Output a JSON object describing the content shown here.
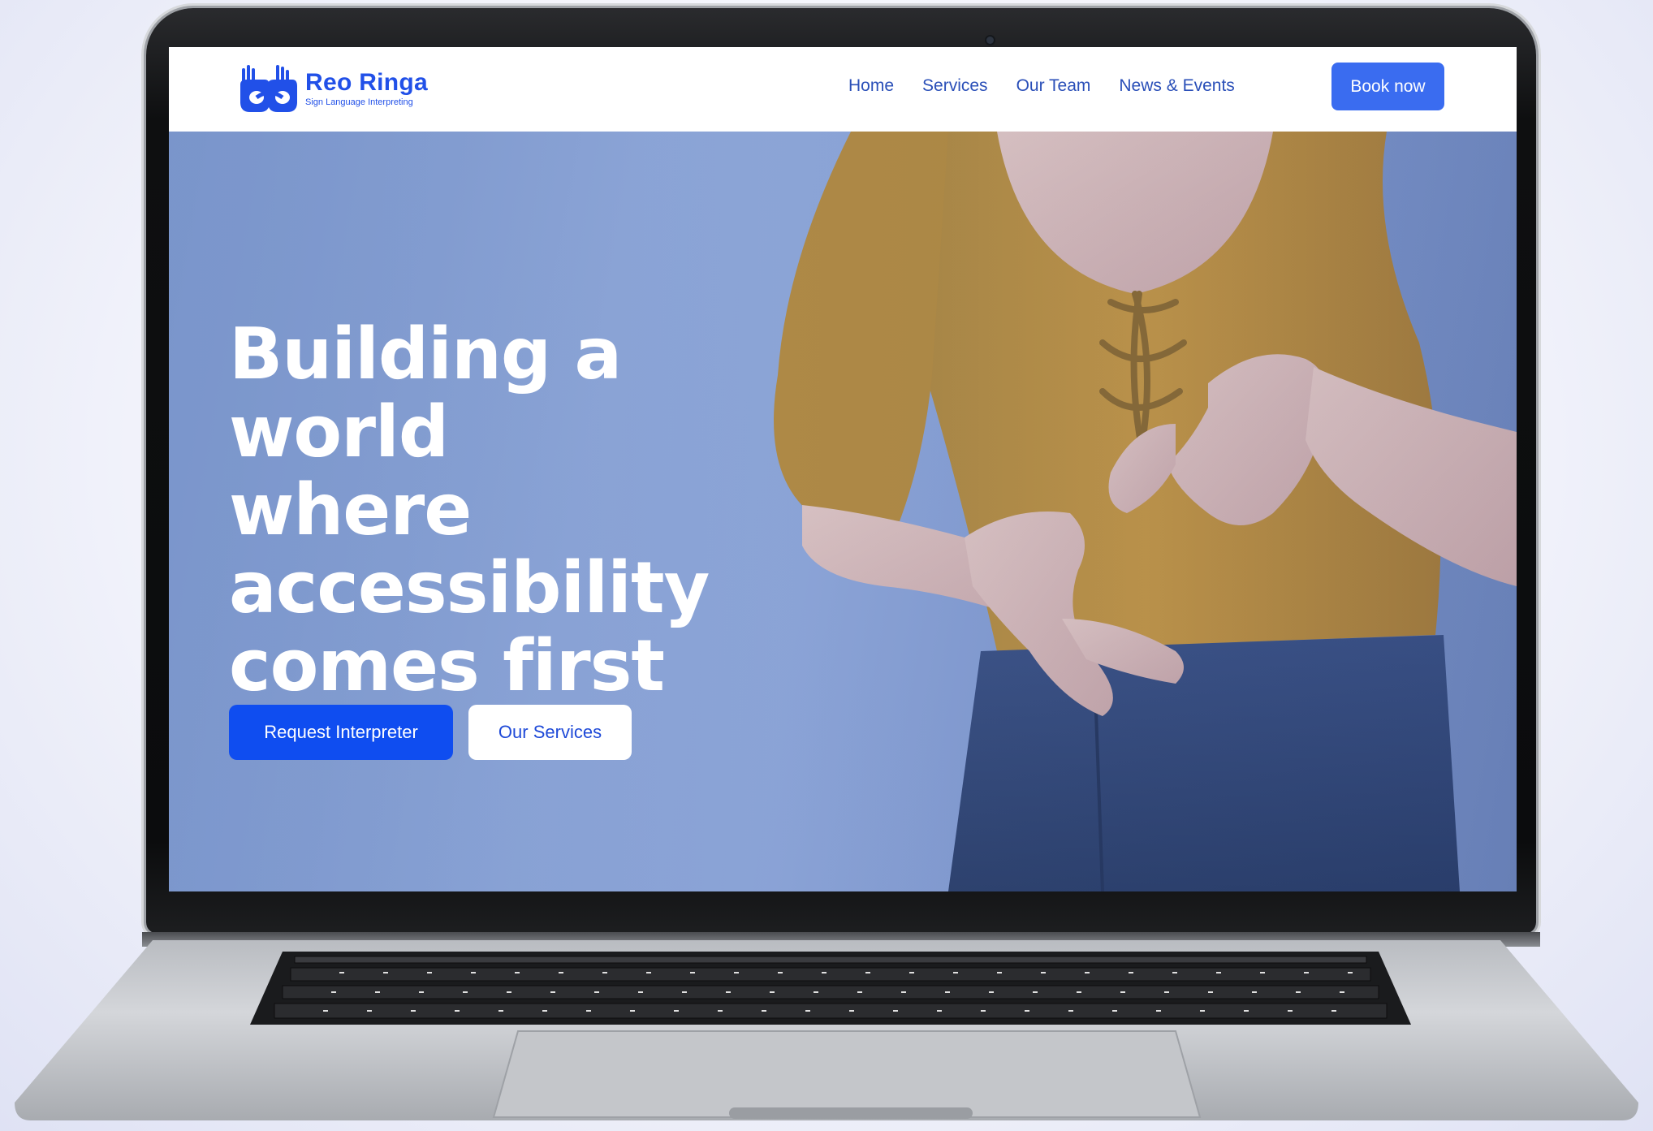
{
  "site": {
    "logo": {
      "name": "Reo Ringa",
      "tagline": "Sign Language Interpreting"
    },
    "nav": {
      "items": [
        {
          "label": "Home"
        },
        {
          "label": "Services"
        },
        {
          "label": "Our Team"
        },
        {
          "label": "News & Events"
        }
      ],
      "cta_label": "Book now"
    },
    "hero": {
      "headline": "Building a world where accessibility comes first",
      "primary_button": "Request Interpreter",
      "secondary_button": "Our Services"
    }
  },
  "colors": {
    "brand_blue": "#2150e8",
    "cta_blue": "#3a6cf0",
    "primary_button": "#0f4df0",
    "hero_tint": "#8ea6d8",
    "shirt": "#c48a2a",
    "jeans": "#2a3e6e"
  },
  "icons": [
    "hands-logo-icon",
    "laptop-keyboard"
  ]
}
